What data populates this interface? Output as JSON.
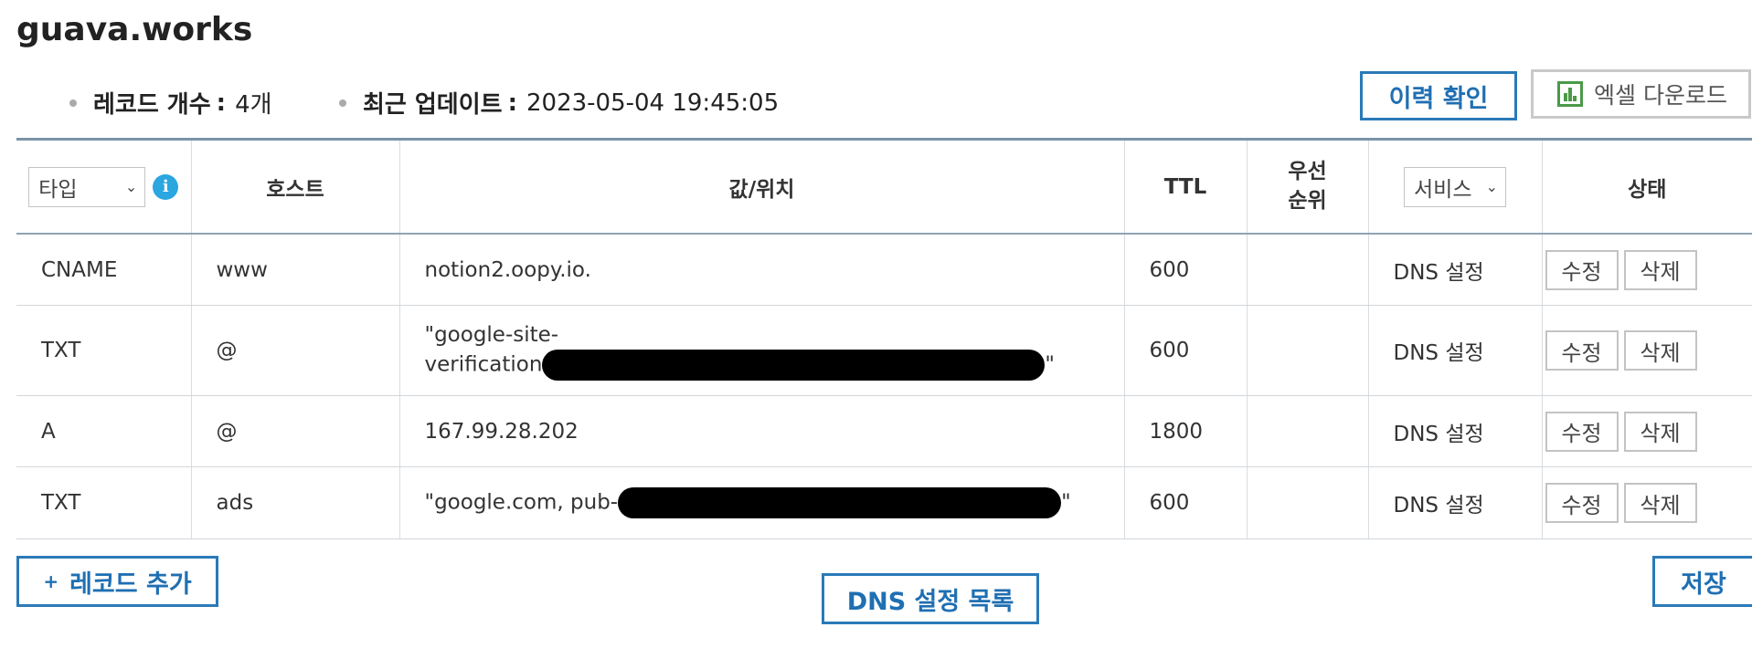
{
  "domain": "guava.works",
  "meta": {
    "record_count_label": "레코드 개수",
    "record_count_value": "4개",
    "last_update_label": "최근 업데이트",
    "last_update_value": "2023-05-04 19:45:05",
    "separator": ":"
  },
  "actions": {
    "history": "이력 확인",
    "excel": "엑셀 다운로드",
    "add_record": "레코드 추가",
    "add_record_icon": "+",
    "dns_list": "DNS 설정 목록",
    "save": "저장"
  },
  "table": {
    "headers": {
      "type": "타입",
      "host": "호스트",
      "value": "값/위치",
      "ttl": "TTL",
      "priority_line1": "우선",
      "priority_line2": "순위",
      "service": "서비스",
      "status": "상태"
    },
    "info_icon": "i",
    "edit_label": "수정",
    "delete_label": "삭제",
    "rows": [
      {
        "type": "CNAME",
        "host": "www",
        "value": "notion2.oopy.io.",
        "ttl": "600",
        "priority": "",
        "service": "DNS 설정"
      },
      {
        "type": "TXT",
        "host": "@",
        "value_line1": "\"google-site-",
        "value_line2": "verification",
        "value_suffix": "\"",
        "ttl": "600",
        "priority": "",
        "service": "DNS 설정"
      },
      {
        "type": "A",
        "host": "@",
        "value": "167.99.28.202",
        "ttl": "1800",
        "priority": "",
        "service": "DNS 설정"
      },
      {
        "type": "TXT",
        "host": "ads",
        "value_prefix": "\"google.com, pub-",
        "value_suffix": "\"",
        "ttl": "600",
        "priority": "",
        "service": "DNS 설정"
      }
    ]
  },
  "colors": {
    "accent": "#1f6fb2",
    "info": "#2aa6e0",
    "excel_green": "#4a9a48"
  }
}
